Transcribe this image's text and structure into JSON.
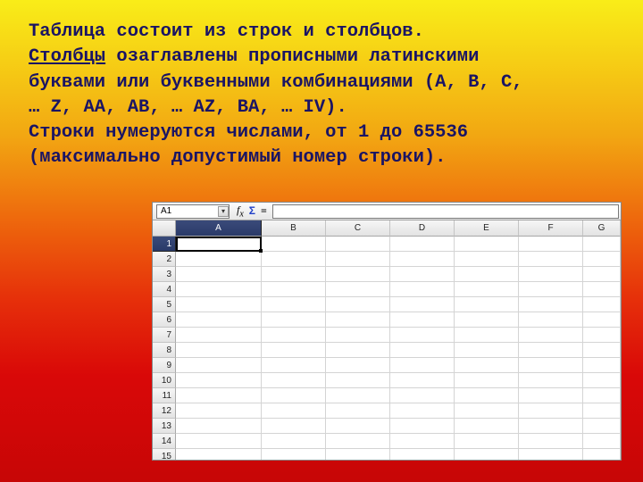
{
  "text": {
    "l1a": "Таблица состоит из строк и столбцов.",
    "l2_u": "Столбцы",
    "l2_r": " озаглавлены прописными латинскими",
    "l3": "буквами или буквенными комбинациями (A, B, C,",
    "l4": "… Z, AA, AB, … AZ, BA, … IV).",
    "l5": "Строки нумеруются числами, от 1 до 65536",
    "l6": "(максимально допустимый номер строки)."
  },
  "sheet": {
    "namebox": "A1",
    "fx": "f",
    "fx_sub": "x",
    "sigma": "Σ",
    "eq": "=",
    "cols": [
      "A",
      "B",
      "C",
      "D",
      "E",
      "F",
      "G"
    ],
    "rows": [
      "1",
      "2",
      "3",
      "4",
      "5",
      "6",
      "7",
      "8",
      "9",
      "10",
      "11",
      "12",
      "13",
      "14",
      "15"
    ],
    "selected_col": "A",
    "selected_row": "1"
  }
}
